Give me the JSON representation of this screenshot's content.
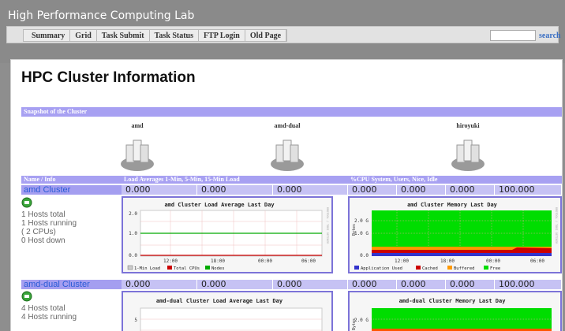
{
  "site": {
    "title": "High Performance Computing Lab"
  },
  "nav": {
    "items": [
      "Summary",
      "Grid",
      "Task Submit",
      "Task Status",
      "FTP Login",
      "Old Page"
    ],
    "search_label": "search",
    "search_value": ""
  },
  "page": {
    "title": "HPC Cluster Information",
    "snapshot_header": "Snapshot of the Cluster",
    "snapshot_clusters": [
      "amd",
      "amd-dual",
      "hiroyuki"
    ],
    "col_headers": {
      "name": "Name / Info",
      "load": "Load Averages 1-Min, 5-Min, 15-Min Load",
      "cpu": "%CPU System, Users, Nice, Idle"
    }
  },
  "clusters": [
    {
      "name": "amd Cluster",
      "load": [
        "0.000",
        "0.000",
        "0.000"
      ],
      "cpu": [
        "0.000",
        "0.000",
        "0.000",
        "100.000"
      ],
      "info": [
        "1 Hosts total",
        "1 Hosts running",
        "( 2 CPUs)",
        "0 Host down"
      ],
      "load_graph": {
        "title": "amd Cluster Load Average Last Day",
        "y_ticks": [
          "2.0",
          "1.0",
          "0.0"
        ],
        "x_ticks": [
          "12:00",
          "18:00",
          "00:00",
          "06:00"
        ],
        "legend": [
          "1-Min Load",
          "Total CPUs",
          "Nodes"
        ],
        "legend_colors": [
          "#cccccc",
          "#cc0000",
          "#00aa00"
        ],
        "side_text": "RRDTOOL / TOBI OETIKER"
      },
      "mem_graph": {
        "title": "amd Cluster Memory Last Day",
        "y_label": "Bytes",
        "y_ticks": [
          "2.0 G",
          "1.0 G",
          "0.0"
        ],
        "x_ticks": [
          "12:00",
          "18:00",
          "00:00",
          "06:00"
        ],
        "legend": [
          "Application Used",
          "Cached",
          "Buffered",
          "Free"
        ],
        "legend_colors": [
          "#3333cc",
          "#cc0000",
          "#ff9900",
          "#00dd00"
        ],
        "side_text": "RRDTOOL / TOBI OETIKER"
      }
    },
    {
      "name": "amd-dual Cluster",
      "load": [
        "0.000",
        "0.000",
        "0.000"
      ],
      "cpu": [
        "0.000",
        "0.000",
        "0.000",
        "100.000"
      ],
      "info": [
        "4 Hosts total",
        "4 Hosts running"
      ],
      "load_graph": {
        "title": "amd-dual Cluster Load Average Last Day",
        "y_ticks": [
          "5"
        ],
        "x_ticks": [],
        "legend": [],
        "legend_colors": [],
        "side_text": ""
      },
      "mem_graph": {
        "title": "amd-dual Cluster Memory Last Day",
        "y_label": "Bytes",
        "y_ticks": [
          "2.0 G"
        ],
        "x_ticks": [],
        "legend": [],
        "legend_colors": [],
        "side_text": ""
      }
    }
  ]
}
